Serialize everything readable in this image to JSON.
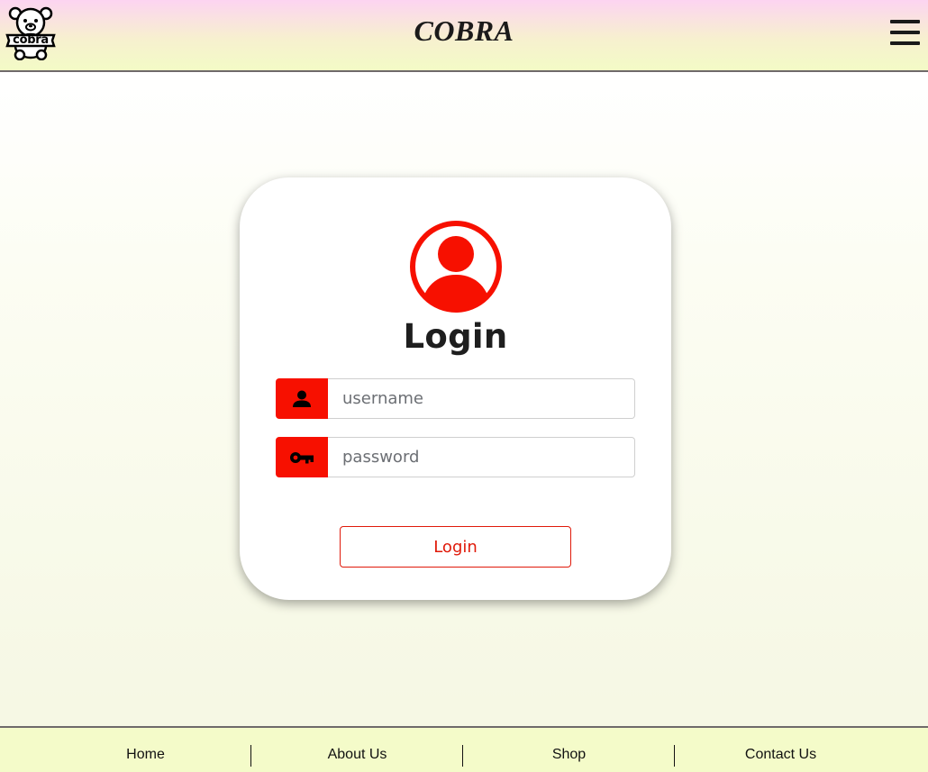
{
  "header": {
    "logo_text": "cobra",
    "brand": "COBRA",
    "menu_icon": "hamburger-menu-icon"
  },
  "login_card": {
    "avatar_icon": "user-avatar-icon",
    "title": "Login",
    "username": {
      "icon": "person-icon",
      "placeholder": "username",
      "value": ""
    },
    "password": {
      "icon": "key-icon",
      "placeholder": "password",
      "value": ""
    },
    "submit_label": "Login"
  },
  "footer": {
    "links": [
      {
        "label": "Home"
      },
      {
        "label": "About Us"
      },
      {
        "label": "Shop"
      },
      {
        "label": "Contact Us"
      }
    ]
  },
  "colors": {
    "accent": "#f71000",
    "header_gradient_top": "#fcd4f1",
    "header_gradient_bottom": "#f3fbc6",
    "footer_bg": "#f4fbc9"
  }
}
